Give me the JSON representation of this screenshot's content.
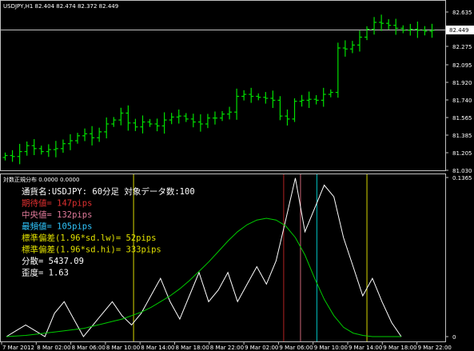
{
  "window": {
    "symbol_header": "USDJPY,H1  82.404 82.474 82.372 82.449",
    "indicator_header": "対数正規分布 0.0000 0.0000",
    "current_price_label": "82.449"
  },
  "colors": {
    "background": "#000000",
    "grid_border": "#c0c0c0",
    "bar": "#00e000",
    "text": "#ffffff",
    "period_vline": "#d8d800",
    "expected_line": "#b22222",
    "median_line": "#cc6677",
    "mode_line": "#00bfbf",
    "fit_curve": "#00cc00",
    "histogram": "#ffffff"
  },
  "info_lines": [
    {
      "text": "通貨名:USDJPY: 60分足 対象データ数:100",
      "color": "#ffffff"
    },
    {
      "text": "期待値= 147pips",
      "color": "#e03030"
    },
    {
      "text": "中央値= 132pips",
      "color": "#e07a9a"
    },
    {
      "text": "最頻値= 105pips",
      "color": "#30c8ff"
    },
    {
      "text": "標準偏差(1.96*sd.lw)= 52pips",
      "color": "#e0e000"
    },
    {
      "text": "標準偏差(1.96*sd.hi)= 333pips",
      "color": "#e0e000"
    },
    {
      "text": "分散= 5437.09",
      "color": "#ffffff"
    },
    {
      "text": "歪度= 1.63",
      "color": "#ffffff"
    }
  ],
  "chart_data": [
    {
      "type": "ohlc",
      "title": "USDJPY,H1",
      "y_ticks": [
        "82.635",
        "82.449",
        "82.275",
        "82.095",
        "81.920",
        "81.740",
        "81.565",
        "81.385",
        "81.205",
        "81.030"
      ],
      "ylim": [
        81.03,
        82.635
      ],
      "current_price": 82.449,
      "close_values": [
        81.18,
        81.17,
        81.22,
        81.28,
        81.25,
        81.22,
        81.24,
        81.25,
        81.3,
        81.33,
        81.38,
        81.4,
        81.36,
        81.42,
        81.5,
        81.54,
        81.61,
        81.51,
        81.47,
        81.52,
        81.5,
        81.48,
        81.54,
        81.57,
        81.58,
        81.55,
        81.52,
        81.5,
        81.56,
        81.56,
        81.6,
        81.62,
        81.78,
        81.8,
        81.78,
        81.77,
        81.76,
        81.74,
        81.58,
        81.55,
        81.73,
        81.74,
        81.75,
        81.74,
        81.8,
        81.82,
        82.27,
        82.26,
        82.3,
        82.38,
        82.46,
        82.53,
        82.52,
        82.5,
        82.47,
        82.45,
        82.46,
        82.45,
        82.44,
        82.449
      ]
    },
    {
      "type": "line",
      "title": "対数正規分布",
      "y_ticks": [
        "0.1365",
        "0"
      ],
      "ylim": [
        0,
        0.1365
      ],
      "histogram_values": [
        0,
        0.005,
        0.01,
        0.005,
        0,
        0.02,
        0.03,
        0.015,
        0,
        0.01,
        0.02,
        0.03,
        0.018,
        0.01,
        0.02,
        0.035,
        0.05,
        0.03,
        0.015,
        0.035,
        0.055,
        0.03,
        0.04,
        0.055,
        0.03,
        0.045,
        0.06,
        0.045,
        0.065,
        0.1,
        0.136,
        0.09,
        0.11,
        0.13,
        0.12,
        0.085,
        0.06,
        0.035,
        0.05,
        0.03,
        0.012,
        0
      ],
      "curve_values": [
        0,
        0.0005,
        0.001,
        0.002,
        0.003,
        0.004,
        0.005,
        0.006,
        0.007,
        0.009,
        0.011,
        0.013,
        0.015,
        0.018,
        0.021,
        0.025,
        0.03,
        0.035,
        0.041,
        0.048,
        0.056,
        0.064,
        0.073,
        0.082,
        0.09,
        0.096,
        0.1,
        0.1015,
        0.1,
        0.095,
        0.085,
        0.07,
        0.05,
        0.032,
        0.018,
        0.008,
        0.003,
        0.001,
        0,
        0,
        0,
        0
      ],
      "vertical_markers": [
        {
          "name": "sd-lw",
          "color": "#d8d800",
          "at": 0.298
        },
        {
          "name": "expected",
          "color": "#b22222",
          "at": 0.637
        },
        {
          "name": "median",
          "color": "#cc6677",
          "at": 0.675
        },
        {
          "name": "mode",
          "color": "#00bfbf",
          "at": 0.712
        },
        {
          "name": "sd-hi",
          "color": "#d8d800",
          "at": 0.825
        }
      ]
    }
  ],
  "x_axis": {
    "labels": [
      "7 Mar 2012",
      "8 Mar 02:00",
      "8 Mar 06:00",
      "8 Mar 10:00",
      "8 Mar 14:00",
      "8 Mar 18:00",
      "8 Mar 22:00",
      "9 Mar 02:00",
      "9 Mar 06:00",
      "9 Mar 10:00",
      "9 Mar 14:00",
      "9 Mar 18:00",
      "9 Mar 22:00"
    ]
  }
}
